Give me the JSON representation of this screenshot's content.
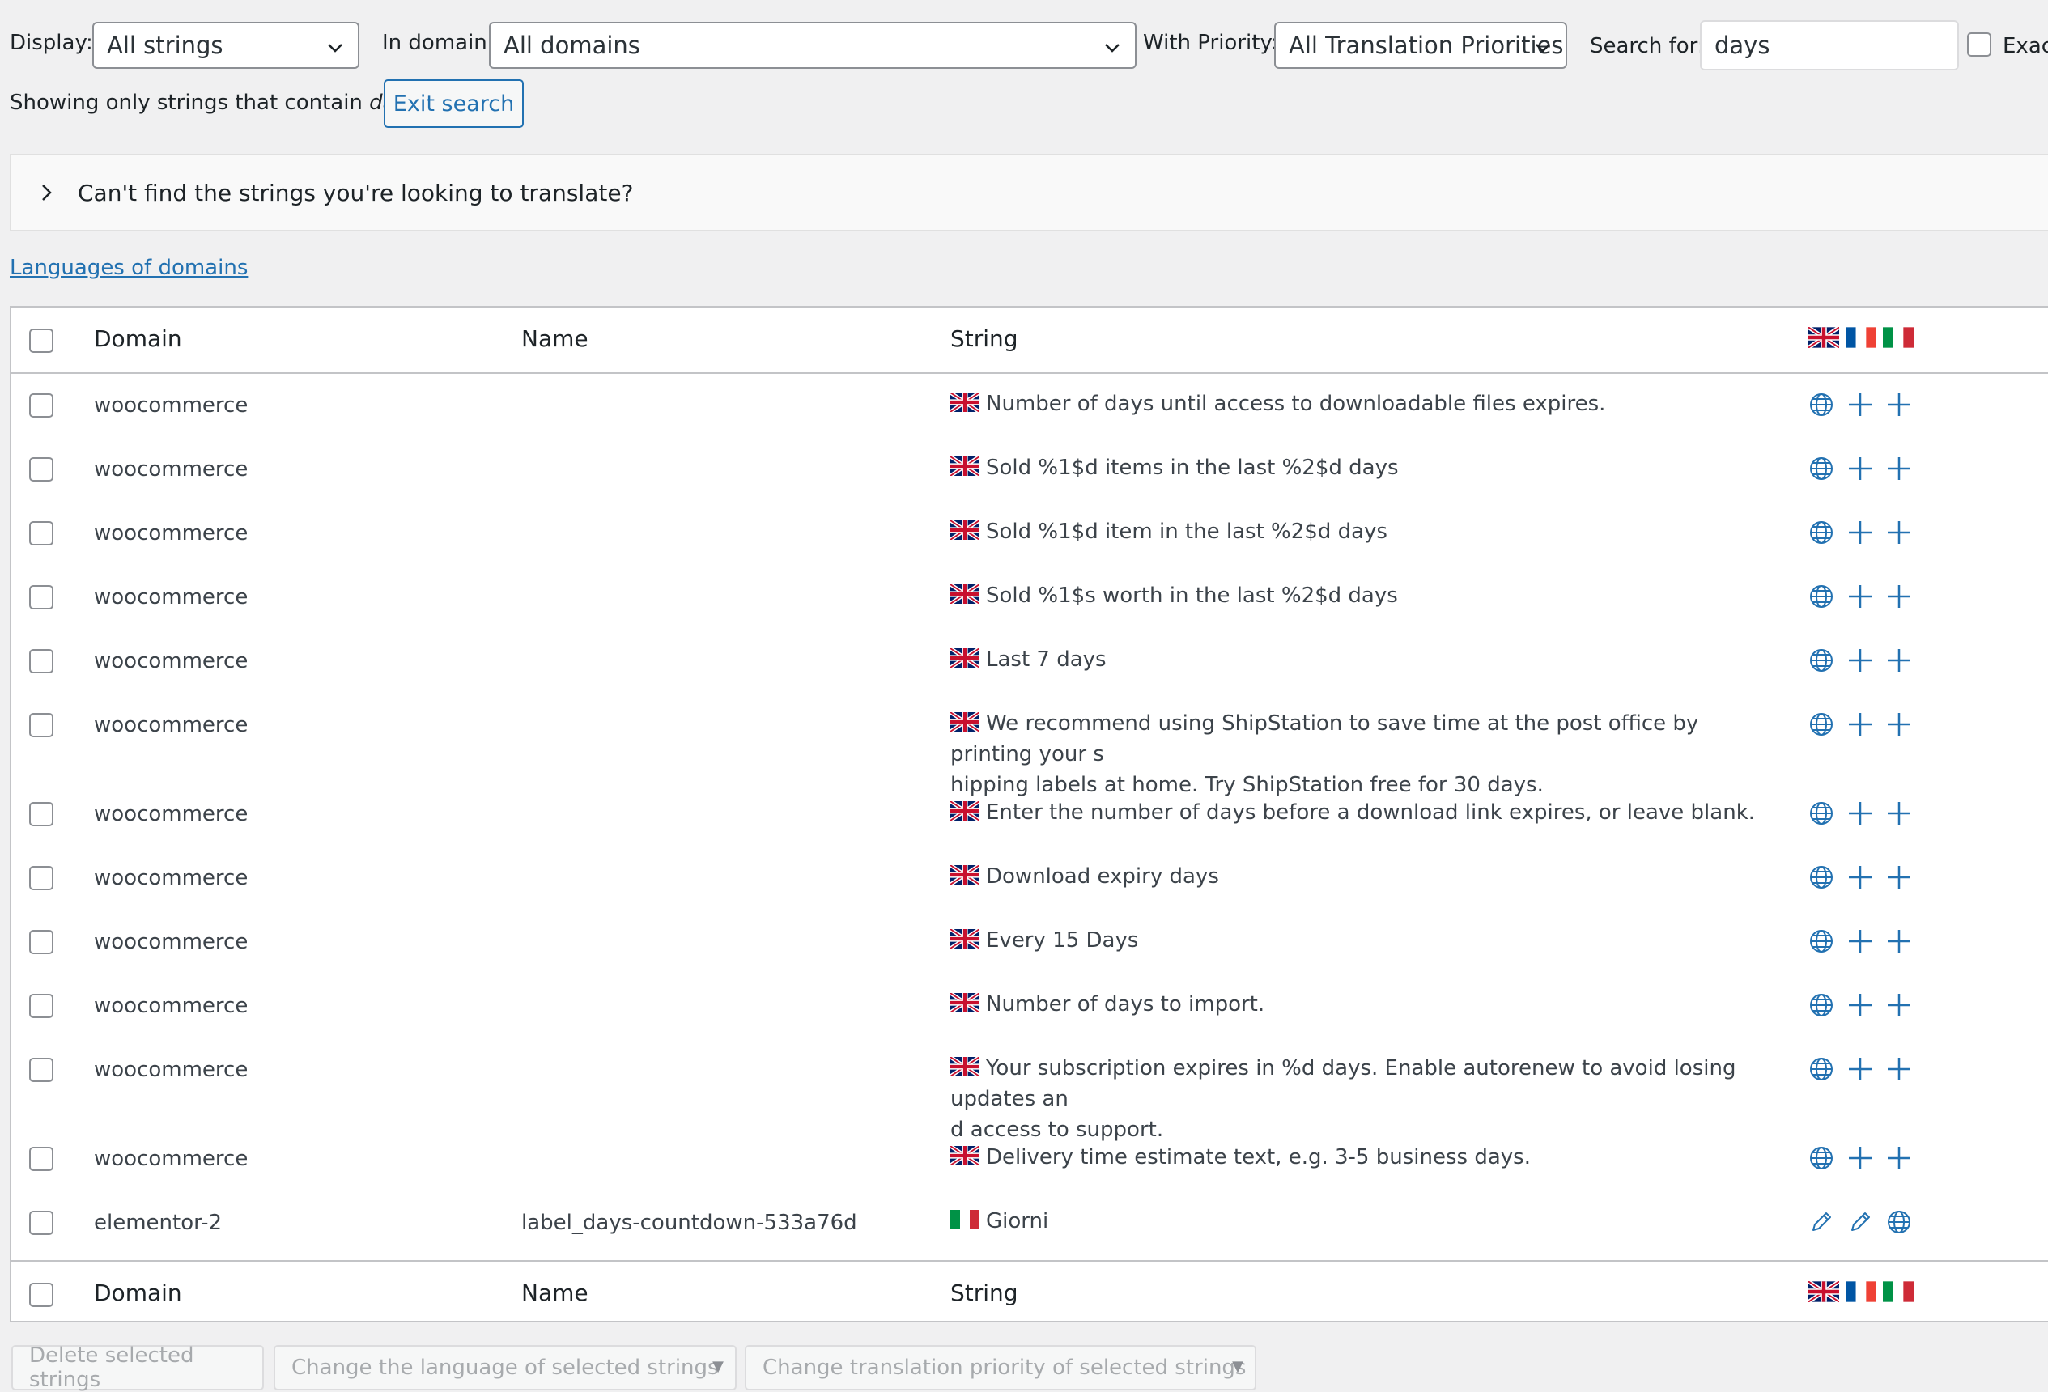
{
  "filters": {
    "display_label": "Display:",
    "display_value": "All strings",
    "domain_label": "In domain:",
    "domain_value": "All domains",
    "priority_label": "With Priority:",
    "priority_value": "All Translation Priorities",
    "search_label": "Search for:",
    "search_value": "days",
    "exact_label": "Exac"
  },
  "search_notice": {
    "prefix": "Showing only strings that contain",
    "term": "days",
    "exit_label": "Exit search"
  },
  "help_panel": {
    "title": "Can't find the strings you're looking to translate?"
  },
  "languages_link": "Languages of domains",
  "table": {
    "columns": {
      "domain": "Domain",
      "name": "Name",
      "string": "String"
    },
    "rows": [
      {
        "domain": "woocommerce",
        "name": "",
        "flag": "uk",
        "string": "Number of days until access to downloadable files expires.",
        "actions": [
          "globe",
          "plus",
          "plus"
        ]
      },
      {
        "domain": "woocommerce",
        "name": "",
        "flag": "uk",
        "string": "Sold %1$d items in the last %2$d days",
        "actions": [
          "globe",
          "plus",
          "plus"
        ]
      },
      {
        "domain": "woocommerce",
        "name": "",
        "flag": "uk",
        "string": "Sold %1$d item in the last %2$d days",
        "actions": [
          "globe",
          "plus",
          "plus"
        ]
      },
      {
        "domain": "woocommerce",
        "name": "",
        "flag": "uk",
        "string": "Sold %1$s worth in the last %2$d days",
        "actions": [
          "globe",
          "plus",
          "plus"
        ]
      },
      {
        "domain": "woocommerce",
        "name": "",
        "flag": "uk",
        "string": "Last 7 days",
        "actions": [
          "globe",
          "plus",
          "plus"
        ]
      },
      {
        "domain": "woocommerce",
        "name": "",
        "flag": "uk",
        "string": "We recommend using ShipStation to save time at the post office by printing your s",
        "string2": "hipping labels at home. Try ShipStation free for 30 days.",
        "actions": [
          "globe",
          "plus",
          "plus"
        ]
      },
      {
        "domain": "woocommerce",
        "name": "",
        "flag": "uk",
        "string": "Enter the number of days before a download link expires, or leave blank.",
        "actions": [
          "globe",
          "plus",
          "plus"
        ]
      },
      {
        "domain": "woocommerce",
        "name": "",
        "flag": "uk",
        "string": "Download expiry days",
        "actions": [
          "globe",
          "plus",
          "plus"
        ]
      },
      {
        "domain": "woocommerce",
        "name": "",
        "flag": "uk",
        "string": "Every 15 Days",
        "actions": [
          "globe",
          "plus",
          "plus"
        ]
      },
      {
        "domain": "woocommerce",
        "name": "",
        "flag": "uk",
        "string": "Number of days to import.",
        "actions": [
          "globe",
          "plus",
          "plus"
        ]
      },
      {
        "domain": "woocommerce",
        "name": "",
        "flag": "uk",
        "string": "Your subscription expires in %d days. Enable autorenew to avoid losing updates an",
        "string2": "d access to support.",
        "actions": [
          "globe",
          "plus",
          "plus"
        ]
      },
      {
        "domain": "woocommerce",
        "name": "",
        "flag": "uk",
        "string": "Delivery time estimate text, e.g. 3-5 business days.",
        "actions": [
          "globe",
          "plus",
          "plus"
        ]
      },
      {
        "domain": "elementor-2",
        "name": "label_days-countdown-533a76d",
        "flag": "it",
        "string": "Giorni",
        "actions": [
          "pencil",
          "pencil",
          "globe"
        ]
      }
    ]
  },
  "bulk_actions": {
    "delete": "Delete selected strings",
    "change_language": "Change the language of selected strings",
    "change_priority": "Change translation priority of selected strings"
  },
  "colors": {
    "accent": "#2271b1",
    "icon": "#2271b1",
    "border": "#c3c4c7"
  }
}
